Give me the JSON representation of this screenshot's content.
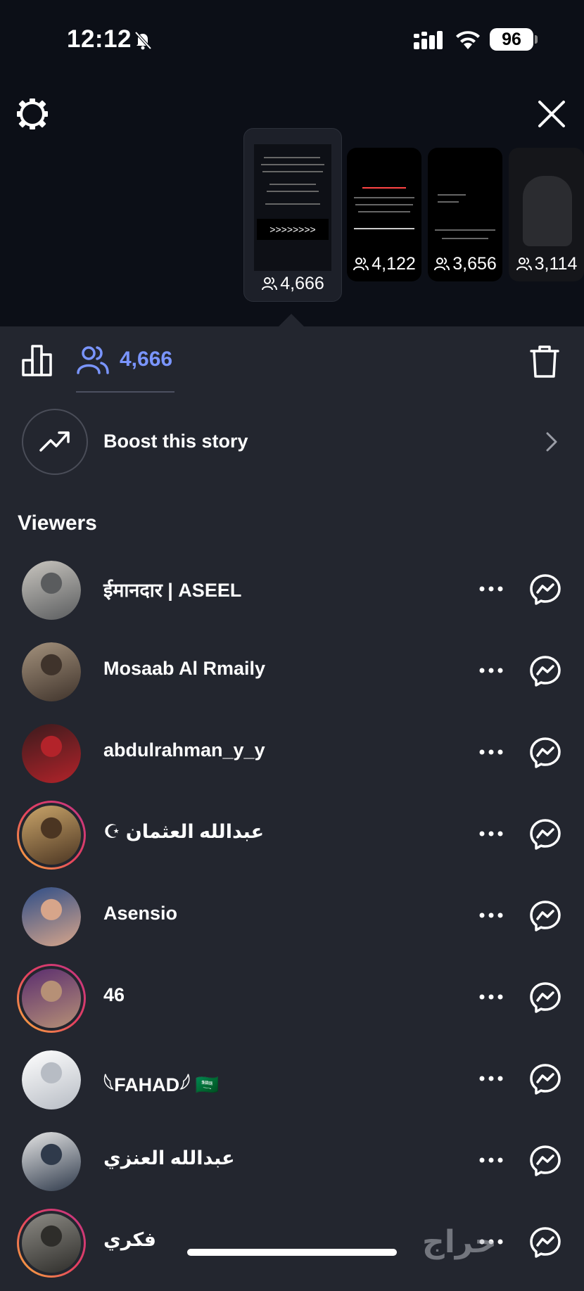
{
  "status_bar": {
    "time": "12:12",
    "battery": "96"
  },
  "thumbnails": [
    {
      "count": "4,666",
      "selected": true,
      "preview_text": ">>>>>>>>"
    },
    {
      "count": "4,122"
    },
    {
      "count": "3,656"
    },
    {
      "count": "3,114"
    }
  ],
  "toolbar": {
    "viewers_count": "4,666"
  },
  "boost": {
    "label": "Boost this story"
  },
  "viewers": {
    "heading": "Viewers",
    "items": [
      {
        "name": "ईमानदार | ASEEL",
        "ring": false,
        "colors": [
          "#c9c6c0",
          "#5a5c5e"
        ]
      },
      {
        "name": "Mosaab Al Rmaily",
        "ring": false,
        "colors": [
          "#a4927d",
          "#3f332b"
        ]
      },
      {
        "name": "abdulrahman_y_y",
        "ring": false,
        "colors": [
          "#3a1b1d",
          "#b3232a"
        ]
      },
      {
        "name": "☪︎ عبدالله العثمان",
        "ring": true,
        "colors": [
          "#caa56a",
          "#4b3522"
        ]
      },
      {
        "name": "Asensio",
        "ring": false,
        "colors": [
          "#2d4d88",
          "#d7a58a"
        ]
      },
      {
        "name": "46",
        "ring": true,
        "colors": [
          "#5a2d6f",
          "#b69076"
        ]
      },
      {
        "name": "𓆩FAHAD𓆪 🇸🇦",
        "ring": false,
        "colors": [
          "#ffffff",
          "#b7bcc4"
        ]
      },
      {
        "name": "عبدالله العنزي",
        "ring": false,
        "colors": [
          "#e6e6e6",
          "#2f3a4b"
        ]
      },
      {
        "name": "فكري",
        "ring": true,
        "colors": [
          "#8d8b85",
          "#2e2d2a"
        ]
      }
    ]
  },
  "watermark": {
    "text": "حراج"
  }
}
